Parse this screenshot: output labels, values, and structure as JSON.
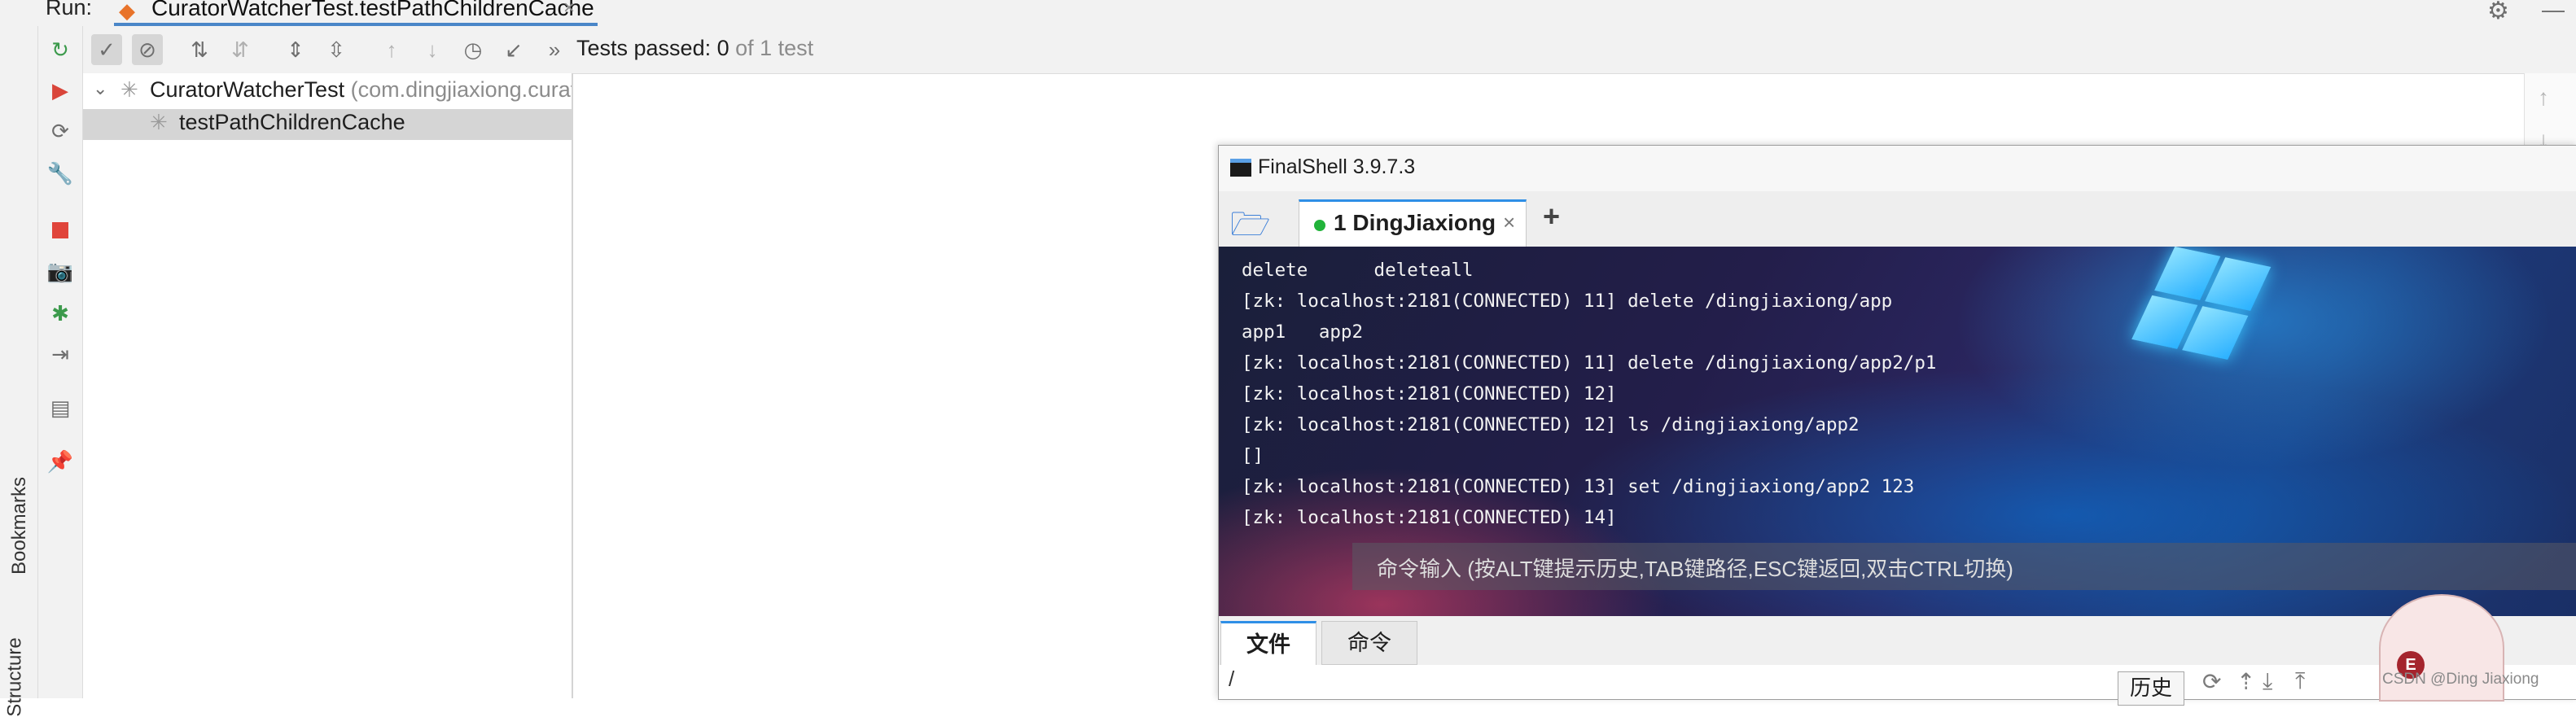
{
  "run_window": {
    "label": "Run:",
    "tab_label": "CuratorWatcherTest.testPathChildrenCache",
    "tab_close": "×"
  },
  "side_labels": {
    "bookmarks": "Bookmarks",
    "structure": "Structure"
  },
  "tests_status": {
    "prefix": "Tests passed: ",
    "count": "0",
    "suffix": " of 1 test"
  },
  "test_tree": [
    {
      "name": "CuratorWatcherTest",
      "detail": " (com.dingjiaxiong.curato"
    },
    {
      "name": "testPathChildrenCache"
    }
  ],
  "finalshell": {
    "title": "FinalShell 3.9.7.3",
    "session_tab": "1 DingJiaxiong",
    "tab_close": "×",
    "add_tab": "+",
    "terminal_lines": [
      "delete      deleteall",
      "[zk: localhost:2181(CONNECTED) 11] delete /dingjiaxiong/app",
      "app1   app2",
      "[zk: localhost:2181(CONNECTED) 11] delete /dingjiaxiong/app2/p1",
      "[zk: localhost:2181(CONNECTED) 12]",
      "[zk: localhost:2181(CONNECTED) 12] ls /dingjiaxiong/app2",
      "[]",
      "[zk: localhost:2181(CONNECTED) 13] set /dingjiaxiong/app2 123",
      "[zk: localhost:2181(CONNECTED) 14]"
    ],
    "command_placeholder": "命令输入 (按ALT键提示历史,TAB键路径,ESC键返回,双击CTRL切换)",
    "bottom_tabs": [
      "文件",
      "命令"
    ],
    "path": "/",
    "history_button": "历史"
  },
  "watermark": "CSDN @Ding Jiaxiong",
  "colors": {
    "accent_blue": "#2f8fe6",
    "connected_green": "#21b33a",
    "run_tab_underline": "#4a86c8"
  }
}
